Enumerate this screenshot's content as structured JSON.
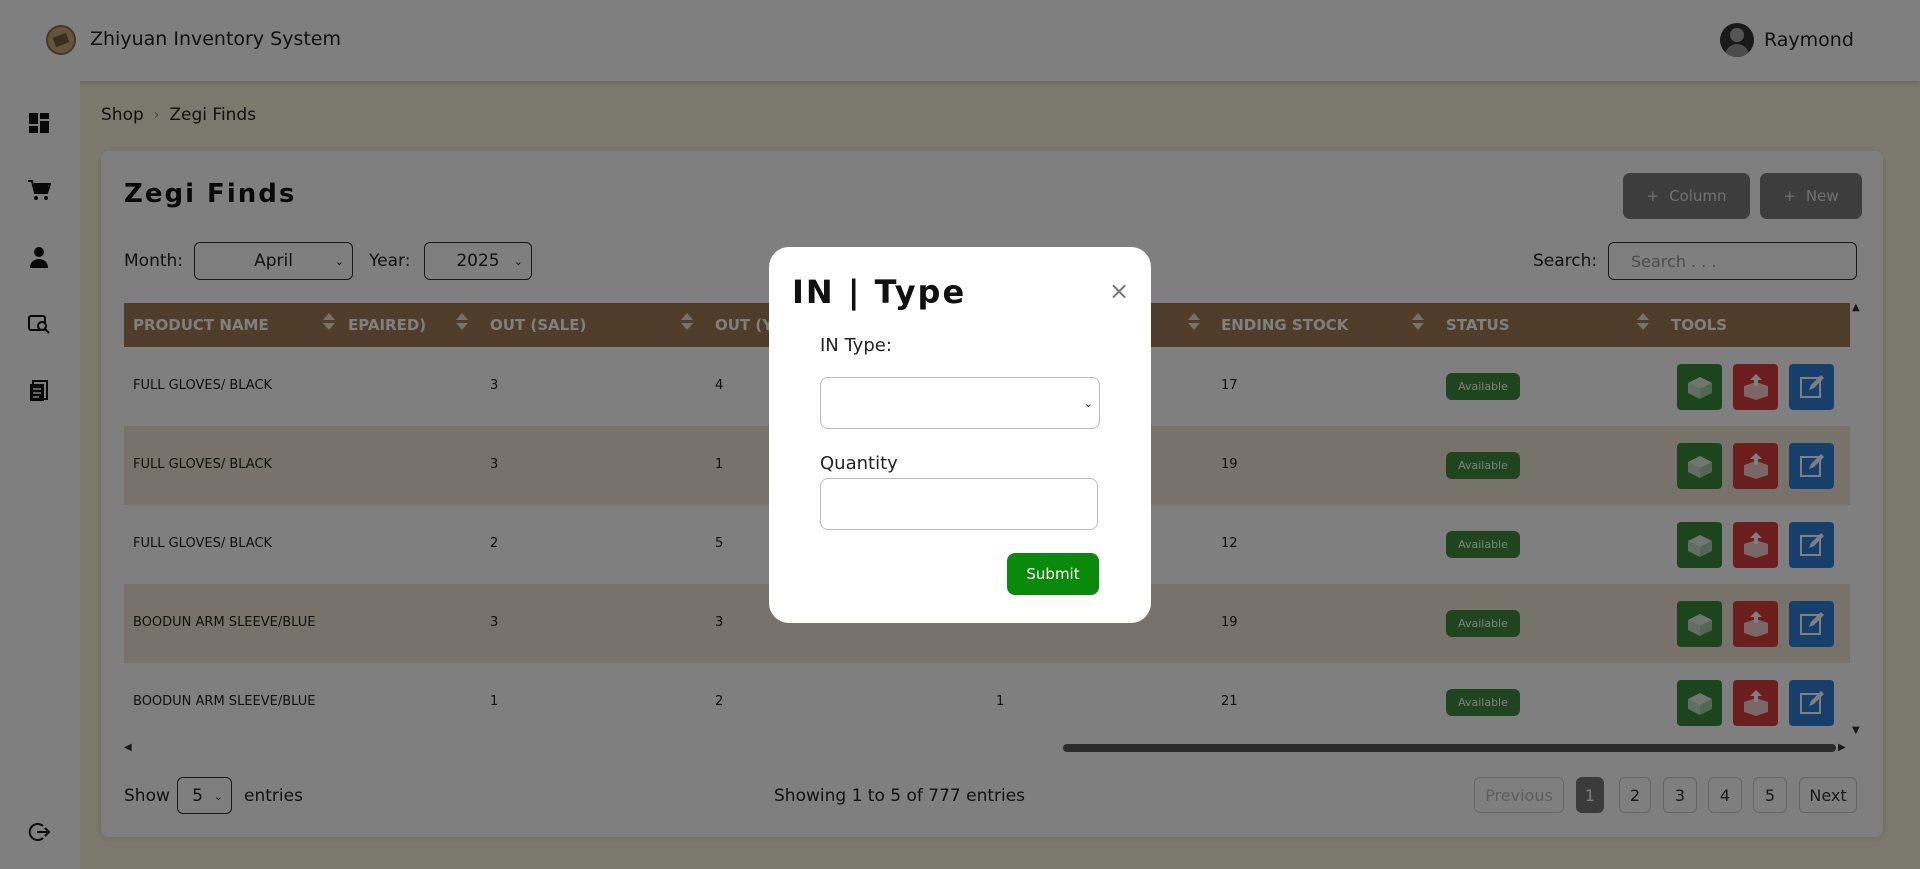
{
  "app": {
    "title": "Zhiyuan Inventory System",
    "user": "Raymond"
  },
  "sidebar": {
    "items": [
      {
        "name": "dashboard-icon"
      },
      {
        "name": "cart-icon"
      },
      {
        "name": "user-icon"
      },
      {
        "name": "money-search-icon"
      },
      {
        "name": "document-icon"
      }
    ],
    "logout": "logout-icon"
  },
  "breadcrumb": {
    "items": [
      "Shop",
      "Zegi Finds"
    ]
  },
  "page": {
    "title": "Zegi Finds",
    "column_label": "Column",
    "new_label": "New",
    "month_label": "Month:",
    "month_value": "April",
    "year_label": "Year:",
    "year_value": "2025",
    "search_label": "Search:",
    "search_placeholder": "Search . . ."
  },
  "table": {
    "headers": [
      "PRODUCT NAME",
      "EPAIRED)",
      "OUT (SALE)",
      "OUT (Y",
      "ENDING STOCK",
      "STATUS",
      "TOOLS"
    ],
    "rows": [
      {
        "product": "FULL GLOVES/ BLACK",
        "out_sale": "3",
        "out_y": "4",
        "mid": "",
        "ending": "17",
        "status": "Available"
      },
      {
        "product": "FULL GLOVES/ BLACK",
        "out_sale": "3",
        "out_y": "1",
        "mid": "",
        "ending": "19",
        "status": "Available"
      },
      {
        "product": "FULL GLOVES/ BLACK",
        "out_sale": "2",
        "out_y": "5",
        "mid": "",
        "ending": "12",
        "status": "Available"
      },
      {
        "product": "BOODUN ARM SLEEVE/BLUE",
        "out_sale": "3",
        "out_y": "3",
        "mid": "",
        "ending": "19",
        "status": "Available"
      },
      {
        "product": "BOODUN ARM SLEEVE/BLUE",
        "out_sale": "1",
        "out_y": "2",
        "mid": "1",
        "ending": "21",
        "status": "Available"
      }
    ]
  },
  "footer": {
    "show_label": "Show",
    "entries_value": "5",
    "entries_label": "entries",
    "info": "Showing 1 to 5 of 777 entries",
    "previous": "Previous",
    "pages": [
      "1",
      "2",
      "3",
      "4",
      "5"
    ],
    "next": "Next"
  },
  "modal": {
    "title": "IN | Type",
    "close": "×",
    "in_type_label": "IN Type:",
    "quantity_label": "Quantity",
    "submit": "Submit"
  }
}
